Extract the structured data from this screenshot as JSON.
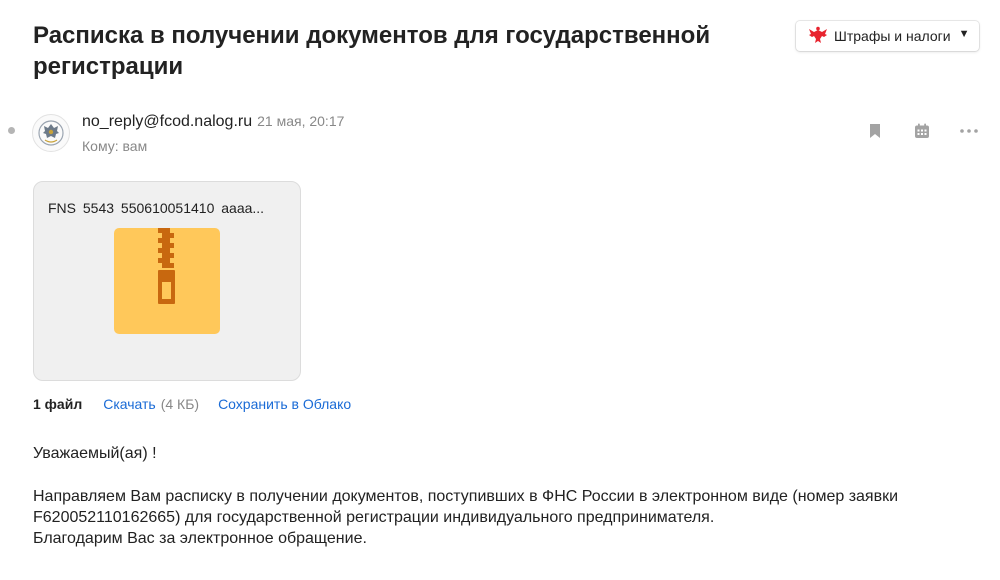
{
  "message": {
    "subject": "Расписка в получении документов для государственной регистрации",
    "label": {
      "text": "Штрафы и налоги",
      "icon": "eagle-emblem-icon",
      "color": "#e8242f"
    },
    "sender": {
      "email": "no_reply@fcod.nalog.ru",
      "date": "21 мая, 20:17"
    },
    "recipient": "Кому: вам",
    "actions": [
      "bookmark-icon",
      "calendar-icon",
      "more-icon"
    ]
  },
  "attachment": {
    "filename": "FNS 5543 550610051410 aaaa...",
    "icon": "zip-archive-icon",
    "icon_color": "#ffc85a",
    "zipper_color": "#c8680f"
  },
  "files": {
    "count": "1 файл",
    "download_label": "Скачать",
    "size": "(4 КБ)",
    "save_label": "Сохранить в Облако",
    "link_color": "#1a6bd6"
  },
  "body": {
    "greeting": "Уважаемый(ая) !",
    "line1": "Направляем Вам расписку в получении документов, поступивших в ФНС России в электронном виде (номер заявки F620052110162665) для государственной регистрации индивидуального предпринимателя.",
    "line2": "Благодарим Вас за электронное обращение."
  }
}
